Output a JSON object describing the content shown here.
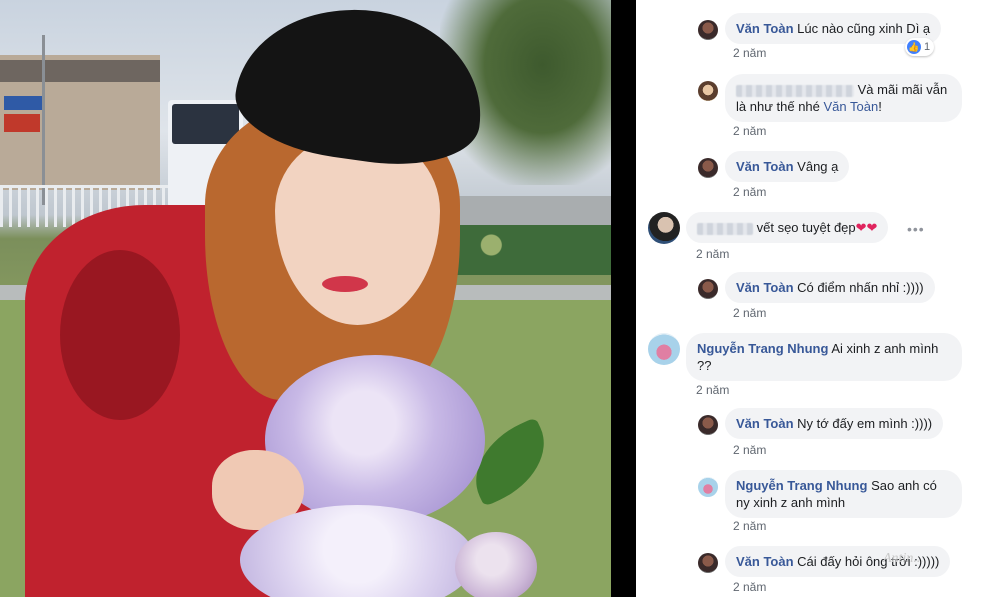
{
  "comments": [
    {
      "author": "Văn Toàn",
      "text": "Lúc nào cũng xinh Dì ạ",
      "time": "2 năm",
      "reactions": "1"
    },
    {
      "author": "Ngọ Thị Thanh Quý",
      "text": "Và mãi mãi vẫn",
      "text_line2": "là như thế nhé ",
      "mention": "Văn Toàn",
      "mention_suffix": "!",
      "time": "2 năm"
    },
    {
      "author": "Văn Toàn",
      "text": "Vâng ạ",
      "time": "2 năm"
    },
    {
      "author": "(hidden)",
      "text": "vết sẹo tuyệt đẹp",
      "emoji": "❤❤",
      "time": "2 năm",
      "more": "•••"
    },
    {
      "author": "Văn Toàn",
      "text": "Có điểm nhấn nhỉ :))))",
      "time": "2 năm"
    },
    {
      "author": "Nguyễn Trang Nhung",
      "text": "Ai xinh z anh mình",
      "text_line2": "??",
      "time": "2 năm"
    },
    {
      "author": "Văn Toàn",
      "text": "Ny tớ đấy em mình :))))",
      "time": "2 năm"
    },
    {
      "author": "Nguyễn Trang Nhung",
      "text": "Sao anh có",
      "text_line2": "ny xinh z anh mình",
      "time": "2 năm"
    },
    {
      "author": "Văn Toàn",
      "text": "Cái đấy hỏi ông trời :)))))",
      "time": "2 năm"
    }
  ],
  "watermark": "Antin...",
  "icons": {
    "like": "like-icon",
    "heart": "heart-icon",
    "more": "more-options-icon"
  },
  "colors": {
    "name": "#385898",
    "bubble": "#f2f3f5",
    "time": "#606770",
    "like": "#4080ff",
    "divider": "#000000"
  }
}
